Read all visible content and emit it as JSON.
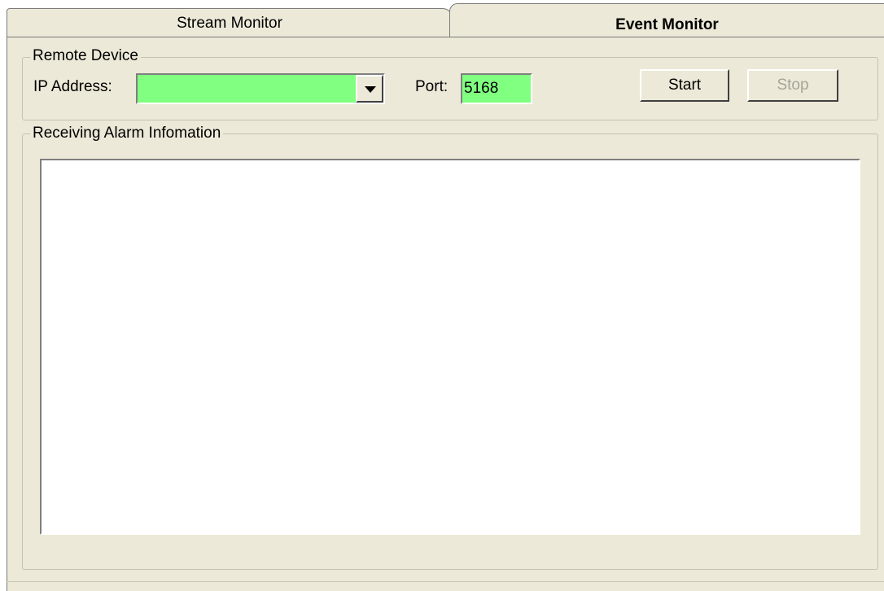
{
  "tabs": [
    {
      "label": "Stream Monitor",
      "active": false
    },
    {
      "label": "Event Monitor",
      "active": true
    }
  ],
  "remote_device": {
    "group_label": "Remote Device",
    "ip_label": "IP Address:",
    "ip_value": "",
    "port_label": "Port:",
    "port_value": "5168",
    "start_label": "Start",
    "stop_label": "Stop"
  },
  "alarm": {
    "group_label": "Receiving Alarm Infomation",
    "entries": []
  },
  "colors": {
    "panel": "#ece9d8",
    "input_highlight": "#80ff80",
    "disabled_text": "#a7a597"
  },
  "icons": {
    "dropdown": "chevron-down-icon"
  }
}
